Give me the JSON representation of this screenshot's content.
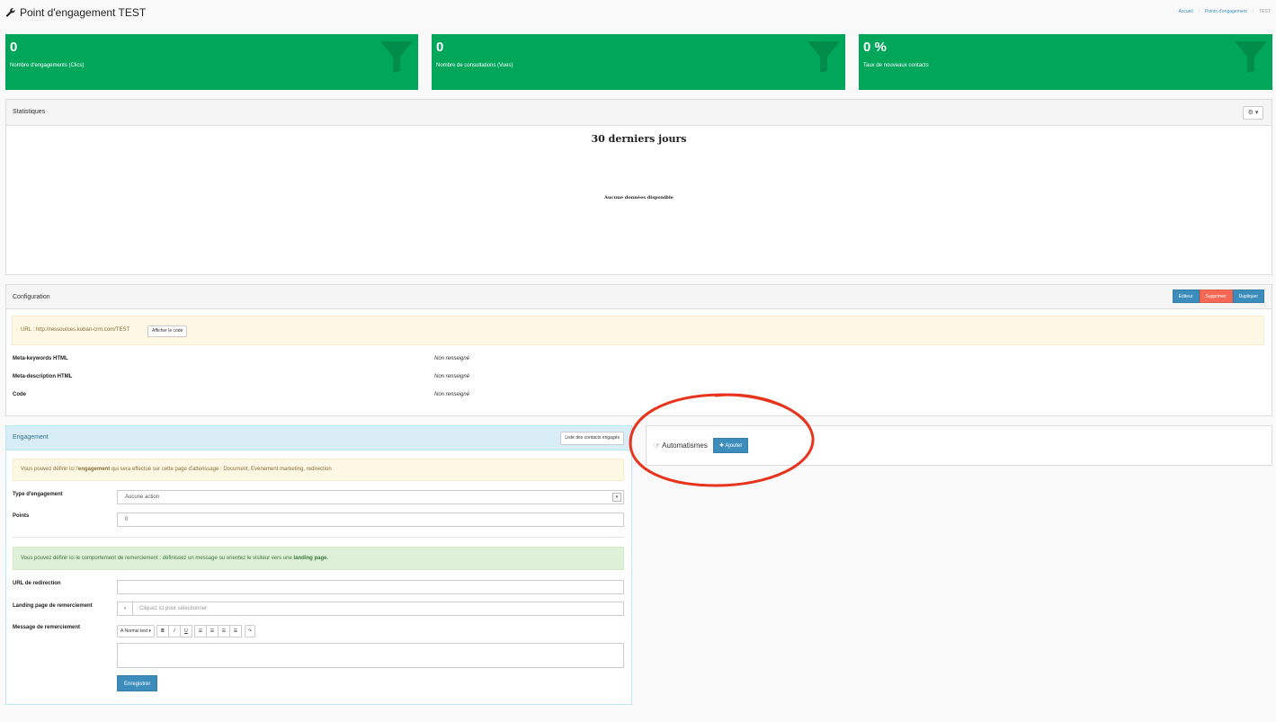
{
  "header": {
    "title": "Point d'engagement TEST",
    "breadcrumb": [
      "Accueil",
      "Points d'engagement",
      "TEST"
    ]
  },
  "tiles": [
    {
      "value": "0",
      "label": "Nombre d'engagements (Clics)"
    },
    {
      "value": "0",
      "label": "Nombre de consultations (Vues)"
    },
    {
      "value": "0 %",
      "label": "Taux de nouveaux contacts"
    }
  ],
  "stats": {
    "title": "Statistiques",
    "chart_title": "30 derniers jours",
    "empty_text": "Aucune données disponible"
  },
  "config": {
    "title": "Configuration",
    "buttons": {
      "edit": "Editeur",
      "delete": "Supprimer",
      "duplicate": "Dupliquer"
    },
    "url_text": "URL : http://ressources.koban-crm.com/TEST",
    "show_code": "Afficher le code",
    "meta": [
      {
        "key": "Meta-keywords HTML",
        "value": "Non renseigné"
      },
      {
        "key": "Meta-description HTML",
        "value": "Non renseigné"
      },
      {
        "key": "Code",
        "value": "Non renseigné"
      }
    ]
  },
  "engagement": {
    "title": "Engagement",
    "list_button": "Liste des contacts engagés",
    "info_pre": "Vous pouvez définir ici l'",
    "info_bold": "engagement",
    "info_post": " qui sera effectué sur cette page d'atterissage : Document, Evènement marketing, redirection",
    "type_label": "Type d'engagement",
    "type_value": "Aucune action",
    "points_label": "Points",
    "points_value": "0",
    "thanks_pre": "Vous pouvez définir ici le comportement de remerciement : définissez un message ou orientez le visiteur vers une ",
    "thanks_bold": "landing page",
    "thanks_post": ".",
    "redirect_label": "URL de redirection",
    "redirect_value": "",
    "landing_label": "Landing page de remerciement",
    "landing_placeholder": "Cliquez ici pour sélectionner",
    "message_label": "Message de remerciement",
    "editor": {
      "text_style": "Normal text",
      "bold": "B",
      "italic": "I",
      "underline": "U"
    },
    "save": "Enregistrer"
  },
  "automatismes": {
    "title": "Automatismes",
    "add": "Ajouter"
  },
  "colors": {
    "tile_green": "#00a65a",
    "primary": "#3c8dbc",
    "danger": "#f56954",
    "annotation": "#e8341c"
  }
}
